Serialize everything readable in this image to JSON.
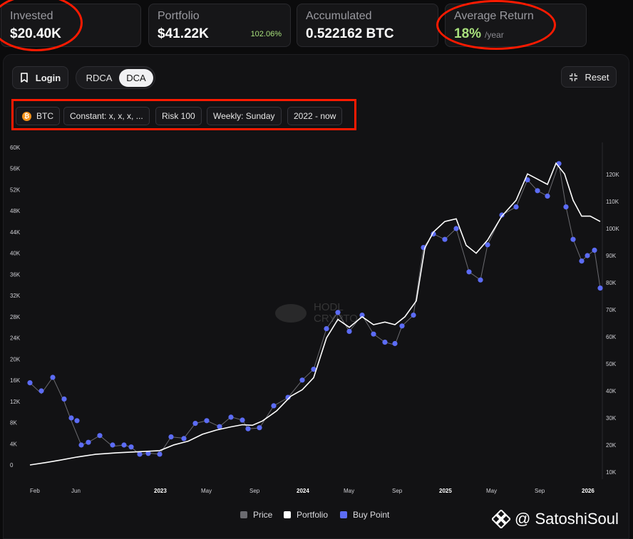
{
  "stats": {
    "invested": {
      "label": "Invested",
      "value": "$20.40K"
    },
    "portfolio": {
      "label": "Portfolio",
      "value": "$41.22K",
      "change": "102.06%"
    },
    "accumulated": {
      "label": "Accumulated",
      "value": "0.522162 BTC"
    },
    "average_return": {
      "label": "Average Return",
      "value": "18%",
      "unit": "/year"
    }
  },
  "toolbar": {
    "login_label": "Login",
    "modes": [
      "RDCA",
      "DCA"
    ],
    "active_mode": "DCA",
    "reset_label": "Reset"
  },
  "filters": {
    "asset": "BTC",
    "amount": "Constant: x, x, x, ...",
    "risk": "Risk 100",
    "frequency": "Weekly: Sunday",
    "range": "2022 - now"
  },
  "watermark_center": [
    "HODL",
    "CRYPTO"
  ],
  "chart_data": {
    "type": "line",
    "x_ticks": [
      {
        "label": "Feb",
        "t": 2022.09,
        "bold": false
      },
      {
        "label": "Jun",
        "t": 2022.42,
        "bold": false
      },
      {
        "label": "2023",
        "t": 2023.0,
        "bold": true
      },
      {
        "label": "May",
        "t": 2023.33,
        "bold": false
      },
      {
        "label": "Sep",
        "t": 2023.67,
        "bold": false
      },
      {
        "label": "2024",
        "t": 2024.0,
        "bold": true
      },
      {
        "label": "May",
        "t": 2024.33,
        "bold": false
      },
      {
        "label": "Sep",
        "t": 2024.67,
        "bold": false
      },
      {
        "label": "2025",
        "t": 2025.0,
        "bold": true
      },
      {
        "label": "May",
        "t": 2025.33,
        "bold": false
      },
      {
        "label": "Sep",
        "t": 2025.67,
        "bold": false
      },
      {
        "label": "2026",
        "t": 2026.0,
        "bold": true
      }
    ],
    "x_range": [
      2022.09,
      2026.09
    ],
    "y_left": {
      "ticks": [
        "0",
        "4K",
        "8K",
        "12K",
        "16K",
        "20K",
        "24K",
        "28K",
        "32K",
        "36K",
        "40K",
        "44K",
        "48K",
        "52K",
        "56K",
        "60K"
      ],
      "range": [
        0,
        60000
      ]
    },
    "y_right": {
      "ticks": [
        "10K",
        "20K",
        "30K",
        "40K",
        "50K",
        "60K",
        "70K",
        "80K",
        "90K",
        "100K",
        "110K",
        "120K"
      ],
      "range": [
        10000,
        130000
      ]
    },
    "series": [
      {
        "name": "Price",
        "color": "#6b6b70",
        "points": [
          [
            2022.09,
            43000
          ],
          [
            2022.17,
            39000
          ],
          [
            2022.25,
            45000
          ],
          [
            2022.33,
            36000
          ],
          [
            2022.38,
            29000
          ],
          [
            2022.45,
            20000
          ],
          [
            2022.5,
            21000
          ],
          [
            2022.58,
            23500
          ],
          [
            2022.67,
            19500
          ],
          [
            2022.75,
            20000
          ],
          [
            2022.8,
            19200
          ],
          [
            2022.86,
            16500
          ],
          [
            2022.92,
            17000
          ],
          [
            2023.0,
            16600
          ],
          [
            2023.08,
            23000
          ],
          [
            2023.17,
            22500
          ],
          [
            2023.25,
            28000
          ],
          [
            2023.33,
            29000
          ],
          [
            2023.42,
            26800
          ],
          [
            2023.5,
            30400
          ],
          [
            2023.58,
            29200
          ],
          [
            2023.62,
            26000
          ],
          [
            2023.7,
            26300
          ],
          [
            2023.8,
            34500
          ],
          [
            2023.9,
            37500
          ],
          [
            2024.0,
            44000
          ],
          [
            2024.08,
            48000
          ],
          [
            2024.17,
            63000
          ],
          [
            2024.25,
            69000
          ],
          [
            2024.33,
            62000
          ],
          [
            2024.42,
            68000
          ],
          [
            2024.5,
            61000
          ],
          [
            2024.58,
            58000
          ],
          [
            2024.65,
            57000
          ],
          [
            2024.7,
            64000
          ],
          [
            2024.78,
            68000
          ],
          [
            2024.85,
            93000
          ],
          [
            2024.92,
            98000
          ],
          [
            2025.0,
            96000
          ],
          [
            2025.08,
            100000
          ],
          [
            2025.17,
            84000
          ],
          [
            2025.25,
            81000
          ],
          [
            2025.3,
            94000
          ],
          [
            2025.4,
            105000
          ],
          [
            2025.5,
            108000
          ],
          [
            2025.58,
            118000
          ],
          [
            2025.65,
            114000
          ],
          [
            2025.72,
            112000
          ],
          [
            2025.8,
            124000
          ],
          [
            2025.85,
            108000
          ],
          [
            2025.9,
            96000
          ],
          [
            2025.96,
            88000
          ],
          [
            2026.0,
            90000
          ],
          [
            2026.05,
            92000
          ],
          [
            2026.09,
            78000
          ]
        ]
      },
      {
        "name": "Portfolio",
        "color": "#ffffff",
        "points": [
          [
            2022.09,
            0
          ],
          [
            2022.2,
            450
          ],
          [
            2022.3,
            900
          ],
          [
            2022.42,
            1500
          ],
          [
            2022.55,
            2000
          ],
          [
            2022.7,
            2300
          ],
          [
            2022.85,
            2500
          ],
          [
            2023.0,
            2700
          ],
          [
            2023.1,
            3800
          ],
          [
            2023.2,
            4500
          ],
          [
            2023.3,
            5800
          ],
          [
            2023.4,
            6600
          ],
          [
            2023.5,
            7200
          ],
          [
            2023.58,
            7600
          ],
          [
            2023.65,
            7500
          ],
          [
            2023.72,
            8300
          ],
          [
            2023.82,
            10200
          ],
          [
            2023.92,
            13000
          ],
          [
            2024.0,
            14200
          ],
          [
            2024.08,
            16500
          ],
          [
            2024.17,
            24000
          ],
          [
            2024.25,
            27500
          ],
          [
            2024.33,
            26000
          ],
          [
            2024.42,
            28000
          ],
          [
            2024.5,
            26500
          ],
          [
            2024.58,
            27000
          ],
          [
            2024.65,
            26500
          ],
          [
            2024.72,
            28000
          ],
          [
            2024.8,
            31000
          ],
          [
            2024.86,
            41000
          ],
          [
            2024.92,
            44000
          ],
          [
            2025.0,
            46000
          ],
          [
            2025.08,
            46500
          ],
          [
            2025.15,
            41500
          ],
          [
            2025.22,
            40000
          ],
          [
            2025.3,
            42500
          ],
          [
            2025.4,
            47000
          ],
          [
            2025.5,
            50000
          ],
          [
            2025.58,
            55000
          ],
          [
            2025.65,
            54000
          ],
          [
            2025.72,
            53000
          ],
          [
            2025.78,
            57000
          ],
          [
            2025.84,
            55000
          ],
          [
            2025.9,
            50000
          ],
          [
            2025.96,
            47000
          ],
          [
            2026.02,
            47000
          ],
          [
            2026.09,
            46000
          ]
        ]
      },
      {
        "name": "Buy Point",
        "color": "#5c6cf5",
        "points": [
          [
            2022.09,
            43000
          ],
          [
            2022.17,
            40000
          ],
          [
            2022.25,
            45000
          ],
          [
            2022.33,
            37000
          ],
          [
            2022.38,
            30000
          ],
          [
            2022.42,
            29000
          ],
          [
            2022.45,
            20000
          ],
          [
            2022.5,
            21000
          ],
          [
            2022.58,
            23500
          ],
          [
            2022.67,
            20000
          ],
          [
            2022.75,
            20000
          ],
          [
            2022.8,
            19300
          ],
          [
            2022.86,
            16600
          ],
          [
            2022.92,
            16900
          ],
          [
            2023.0,
            16600
          ],
          [
            2023.08,
            23000
          ],
          [
            2023.17,
            22400
          ],
          [
            2023.25,
            28000
          ],
          [
            2023.33,
            29000
          ],
          [
            2023.42,
            26800
          ],
          [
            2023.5,
            30300
          ],
          [
            2023.58,
            29200
          ],
          [
            2023.62,
            26000
          ],
          [
            2023.7,
            26400
          ],
          [
            2023.8,
            34500
          ],
          [
            2023.9,
            37600
          ],
          [
            2024.0,
            44000
          ],
          [
            2024.08,
            48000
          ],
          [
            2024.17,
            63000
          ],
          [
            2024.25,
            69000
          ],
          [
            2024.33,
            62000
          ],
          [
            2024.42,
            68000
          ],
          [
            2024.5,
            61000
          ],
          [
            2024.58,
            58000
          ],
          [
            2024.65,
            57500
          ],
          [
            2024.7,
            64000
          ],
          [
            2024.78,
            68000
          ],
          [
            2024.85,
            93000
          ],
          [
            2024.92,
            98000
          ],
          [
            2025.0,
            96000
          ],
          [
            2025.08,
            100000
          ],
          [
            2025.17,
            84000
          ],
          [
            2025.25,
            81000
          ],
          [
            2025.3,
            94000
          ],
          [
            2025.4,
            105000
          ],
          [
            2025.5,
            108000
          ],
          [
            2025.58,
            118000
          ],
          [
            2025.65,
            114000
          ],
          [
            2025.72,
            112000
          ],
          [
            2025.8,
            124000
          ],
          [
            2025.85,
            108000
          ],
          [
            2025.9,
            96000
          ],
          [
            2025.96,
            88000
          ],
          [
            2026.0,
            90000
          ],
          [
            2026.05,
            92000
          ],
          [
            2026.09,
            78000
          ]
        ]
      }
    ]
  },
  "legend": [
    "Price",
    "Portfolio",
    "Buy Point"
  ],
  "watermark": "@ SatoshiSoul"
}
